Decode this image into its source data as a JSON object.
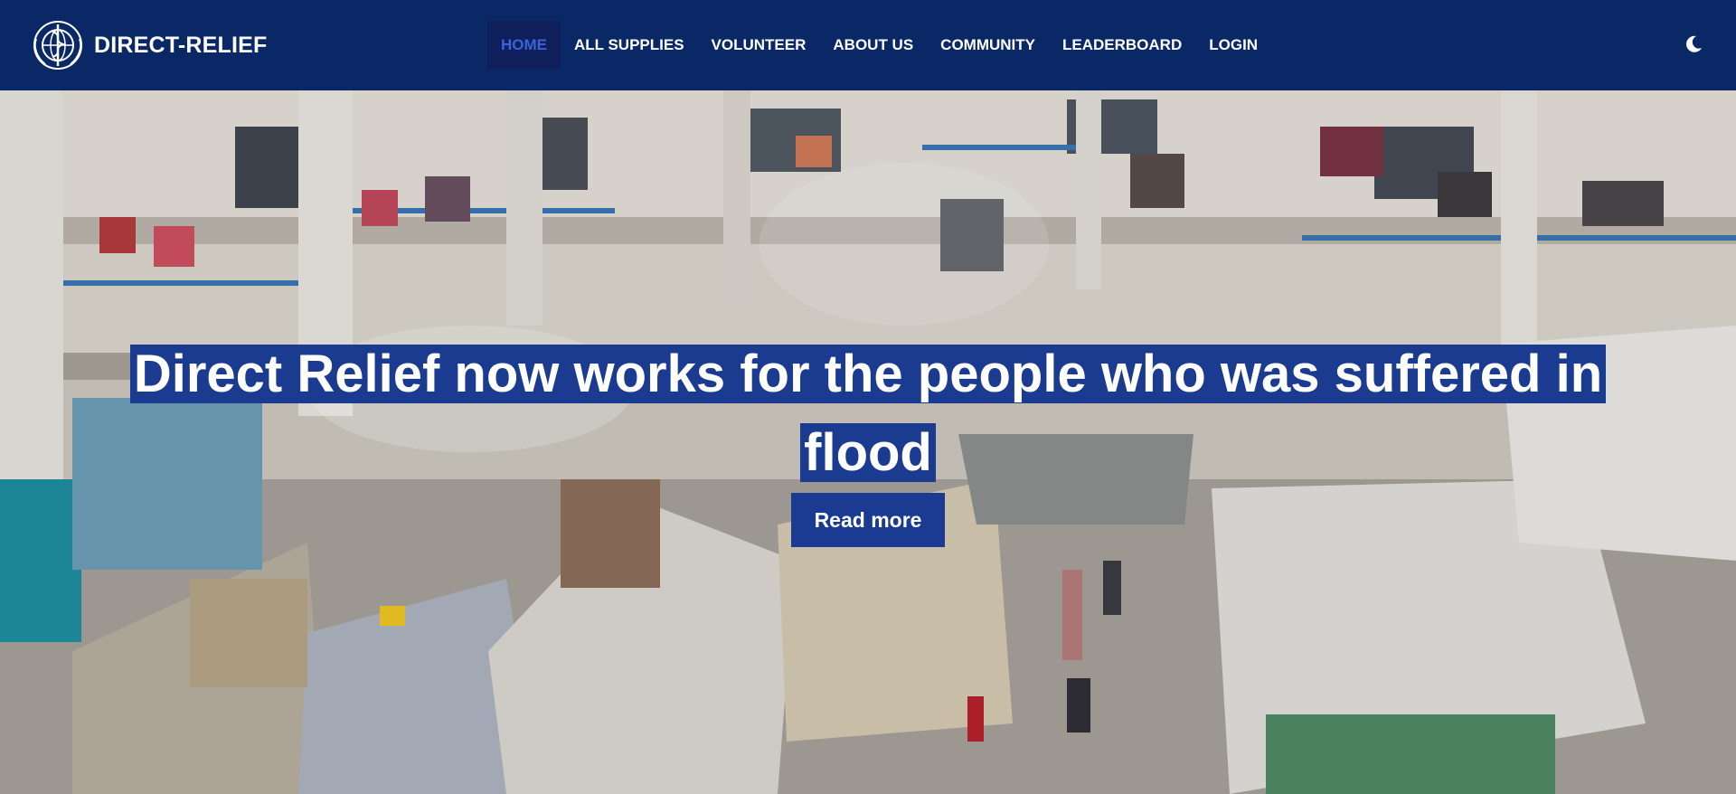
{
  "brand": {
    "name": "DIRECT-RELIEF",
    "logo_icon": "world-health-emblem-icon"
  },
  "nav": {
    "items": [
      {
        "label": "HOME",
        "active": true
      },
      {
        "label": "ALL SUPPLIES",
        "active": false
      },
      {
        "label": "VOLUNTEER",
        "active": false
      },
      {
        "label": "ABOUT US",
        "active": false
      },
      {
        "label": "COMMUNITY",
        "active": false
      },
      {
        "label": "LEADERBOARD",
        "active": false
      },
      {
        "label": "LOGIN",
        "active": false
      }
    ],
    "theme_toggle_icon": "moon-icon"
  },
  "hero": {
    "headline": "Direct Relief now works for the people who was suffered in flood",
    "read_more_label": "Read more"
  },
  "colors": {
    "navbar": "#0b2866",
    "active_nav_text": "#3a63d8",
    "headline_highlight": "#1a3b90",
    "button": "#1b3b92"
  }
}
